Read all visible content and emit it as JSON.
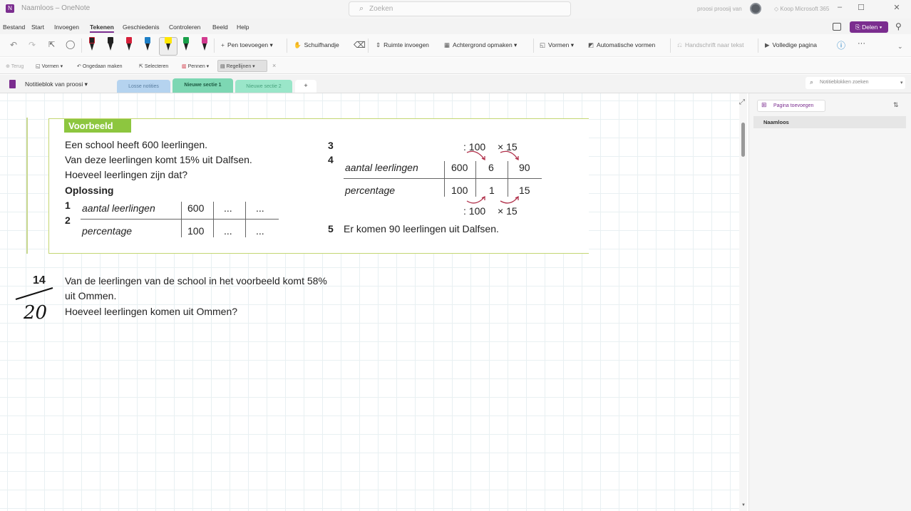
{
  "titlebar": {
    "title": "Naamloos – OneNote",
    "search_placeholder": "Zoeken",
    "user": "proosi proosij van",
    "buy": "Koop Microsoft 365",
    "minimize": "–",
    "maximize": "☐",
    "close": "✕"
  },
  "menu": {
    "items": [
      "Bestand",
      "Start",
      "Invoegen",
      "Tekenen",
      "Geschiedenis",
      "Controleren",
      "Beeld",
      "Help"
    ],
    "active": "Tekenen",
    "share": "Delen"
  },
  "ribbon": {
    "add_pen": "Pen toevoegen",
    "hand": "Schuifhandje",
    "insert_space": "Ruimte invoegen",
    "background": "Achtergrond opmaken",
    "shapes": "Vormen",
    "auto_shapes": "Automatische vormen",
    "ink_to_text": "Handschrift naar tekst",
    "full_page": "Volledige pagina",
    "more": "···"
  },
  "subribbon": {
    "back": "Terug",
    "shapes": "Vormen",
    "undo_stroke": "Ongedaan maken",
    "select": "Selecteren",
    "pens": "Pennen",
    "rule_lines": "Regellijnen"
  },
  "notebook": {
    "name": "Notitieblok van proosi",
    "sections": [
      "Losse notities",
      "Nieuwe sectie 1",
      "Nieuwe sectie 2"
    ],
    "add_section": "+",
    "search_placeholder": "Notitieblokken zoeken"
  },
  "pages": {
    "add_page": "Pagina toevoegen",
    "items": [
      "Naamloos"
    ]
  },
  "content": {
    "example_label": "Voorbeeld",
    "question": [
      "Een school heeft 600 leerlingen.",
      "Van deze leerlingen komt 15% uit Dalfsen.",
      "Hoeveel leerlingen zijn dat?"
    ],
    "solution_label": "Oplossing",
    "steps": [
      "1",
      "2",
      "3",
      "4",
      "5"
    ],
    "table_left": {
      "row1_label": "aantal leerlingen",
      "row1": [
        "600",
        "...",
        "..."
      ],
      "row2_label": "percentage",
      "row2": [
        "100",
        "...",
        "..."
      ]
    },
    "table_right": {
      "top_ops": [
        ": 100",
        "× 15"
      ],
      "row1_label": "aantal leerlingen",
      "row1": [
        "600",
        "6",
        "90"
      ],
      "row2_label": "percentage",
      "row2": [
        "100",
        "1",
        "15"
      ],
      "bottom_ops": [
        ": 100",
        "× 15"
      ]
    },
    "answer": "Er komen 90 leerlingen uit Dalfsen.",
    "exercise_number": "14",
    "exercise": [
      "Van de leerlingen van de school in het voorbeeld komt 58%",
      "uit Ommen.",
      "Hoeveel leerlingen komen uit Ommen?"
    ],
    "handwritten_score": "20"
  }
}
